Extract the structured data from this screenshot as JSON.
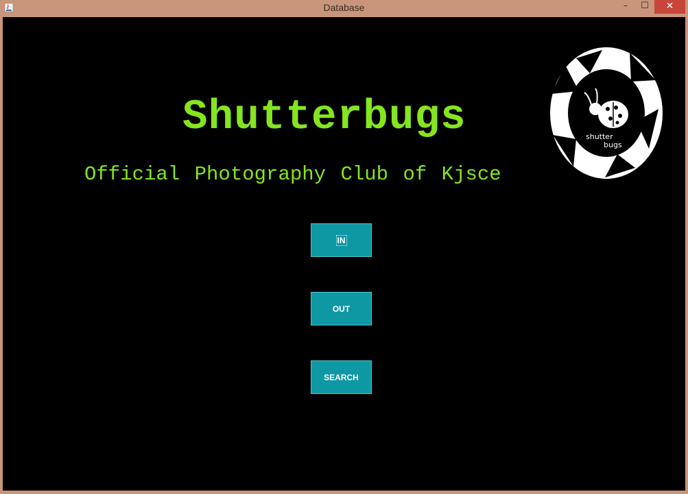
{
  "window": {
    "title": "Database",
    "minimize_glyph": "–",
    "maximize_glyph": "☐",
    "close_glyph": "✕",
    "app_icon": "java-icon"
  },
  "main": {
    "heading": "Shutterbugs",
    "subheading": "Official Photography Club of Kjsce",
    "logo": {
      "line1": "shutter",
      "line2": "bugs",
      "icon": "camera-aperture-ladybug-logo"
    },
    "buttons": {
      "in_label": "IN",
      "out_label": "OUT",
      "search_label": "SEARCH"
    }
  },
  "colors": {
    "titlebar": "#c9967b",
    "background": "#000000",
    "accent_text": "#84e520",
    "button_bg": "#0e98a4",
    "close_button": "#c7453b"
  }
}
